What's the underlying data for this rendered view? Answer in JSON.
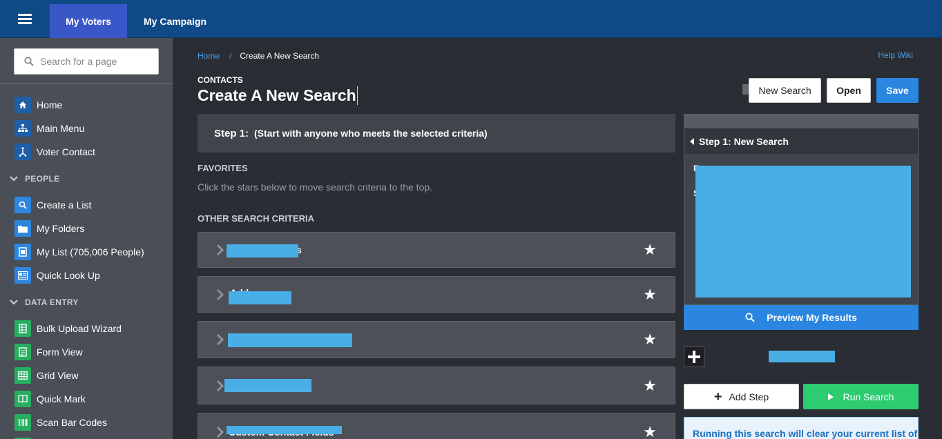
{
  "topbar": {
    "tabs": [
      {
        "label": "My Voters",
        "active": true
      },
      {
        "label": "My Campaign",
        "active": false
      }
    ],
    "colors": {
      "bar": "#104a86",
      "active_tab": "#3a57c7"
    }
  },
  "sidebar": {
    "search_placeholder": "Search for a page",
    "items_top": [
      {
        "label": "Home",
        "icon": "home-icon"
      },
      {
        "label": "Main Menu",
        "icon": "sitemap-icon"
      },
      {
        "label": "Voter Contact",
        "icon": "people-tree-icon"
      }
    ],
    "section_people": "PEOPLE",
    "items_people": [
      {
        "label": "Create a List",
        "icon": "search-icon"
      },
      {
        "label": "My Folders",
        "icon": "folder-icon"
      },
      {
        "label": "My List (705,006 People)",
        "icon": "list-icon"
      },
      {
        "label": "Quick Look Up",
        "icon": "id-card-icon"
      }
    ],
    "section_data_entry": "DATA ENTRY",
    "items_data_entry": [
      {
        "label": "Bulk Upload Wizard",
        "icon": "spreadsheet-icon"
      },
      {
        "label": "Form View",
        "icon": "form-icon"
      },
      {
        "label": "Grid View",
        "icon": "grid-icon"
      },
      {
        "label": "Quick Mark",
        "icon": "book-icon"
      },
      {
        "label": "Scan Bar Codes",
        "icon": "barcode-icon"
      }
    ]
  },
  "breadcrumb": {
    "home": "Home",
    "separator": "/",
    "current": "Create A New Search"
  },
  "help_link": "Help Wiki",
  "header": {
    "kicker": "CONTACTS",
    "title": "Create A New Search",
    "buttons": {
      "new_search": "New Search",
      "open": "Open",
      "save": "Save"
    }
  },
  "step": {
    "label": "Step 1:",
    "description": "(Start with anyone who meets the selected criteria)"
  },
  "favorites": {
    "heading": "FAVORITES",
    "description": "Click the stars below to move search criteria to the top."
  },
  "other_criteria": {
    "heading": "OTHER SEARCH CRITERIA",
    "items": [
      {
        "label": "",
        "partial": "s"
      },
      {
        "label": "",
        "partial": "Add"
      },
      {
        "label": "",
        "partial": ""
      },
      {
        "label": "",
        "partial": ""
      },
      {
        "label": "",
        "partial": "Custom Contact Fields"
      }
    ]
  },
  "right_panel": {
    "header": "Step 1: New Search",
    "peek_line1": "Ev",
    "peek_line2": "S",
    "preview_button": "Preview My Results",
    "add_step": "Add Step",
    "run_search": "Run Search",
    "warning": "Running this search will clear your current list of"
  },
  "accent_colors": {
    "link": "#4a9fe8",
    "primary": "#2a86e0",
    "success": "#2ecc71",
    "redaction": "#4aaee6"
  }
}
